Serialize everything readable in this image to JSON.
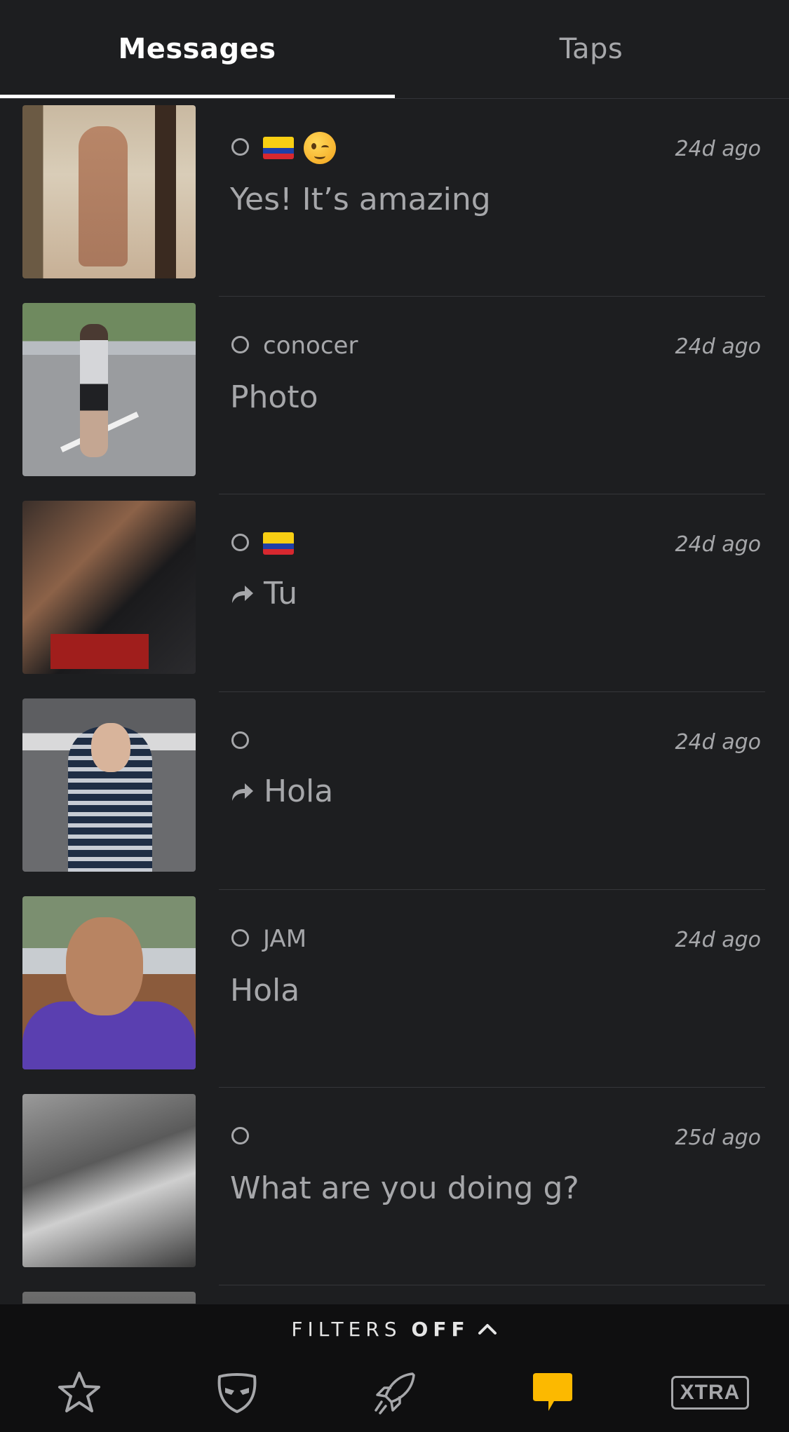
{
  "tabs": {
    "messages": "Messages",
    "taps": "Taps",
    "active": "messages"
  },
  "conversations": [
    {
      "name": "",
      "badges": [
        "colombia-flag",
        "winking-face-emoji"
      ],
      "time": "24d ago",
      "message": "Yes! It’s amazing",
      "forwarded": false
    },
    {
      "name": "conocer",
      "badges": [],
      "time": "24d ago",
      "message": "Photo",
      "forwarded": false
    },
    {
      "name": "",
      "badges": [
        "colombia-flag"
      ],
      "time": "24d ago",
      "message": "Tu",
      "forwarded": true
    },
    {
      "name": "",
      "badges": [],
      "time": "24d ago",
      "message": "Hola",
      "forwarded": true
    },
    {
      "name": "JAM",
      "badges": [],
      "time": "24d ago",
      "message": "Hola",
      "forwarded": false
    },
    {
      "name": "",
      "badges": [],
      "time": "25d ago",
      "message": "What are you doing g?",
      "forwarded": false
    }
  ],
  "filters": {
    "label": "FILTERS",
    "state": "OFF"
  },
  "nav": {
    "items": [
      "favorites-star-icon",
      "grindr-mask-icon",
      "explore-rocket-icon",
      "messages-chat-icon",
      "xtra-badge"
    ],
    "xtra_label": "XTRA",
    "active": "messages-chat-icon"
  },
  "colors": {
    "background": "#1d1e20",
    "text": "#a6a7aa",
    "active_tab": "#ffffff",
    "accent": "#fcb900",
    "bottom_bar": "#0f0f10"
  }
}
